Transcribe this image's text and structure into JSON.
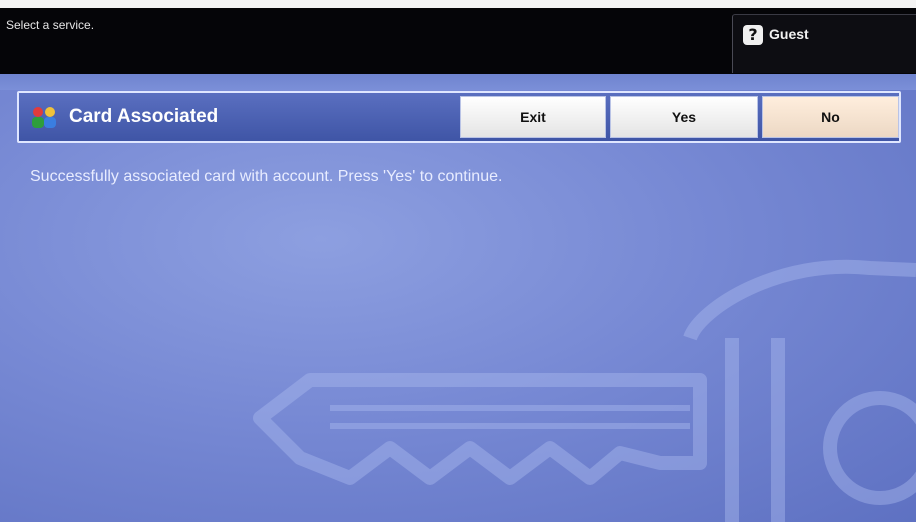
{
  "topbar": {
    "status_text": "Select a service.",
    "user_label": "Guest",
    "user_icon": "guest-user-icon"
  },
  "panel": {
    "title": "Card Associated",
    "title_icon": "people-icon",
    "buttons": {
      "exit": "Exit",
      "yes": "Yes",
      "no": "No"
    }
  },
  "message": "Successfully associated card with account. Press 'Yes' to continue.",
  "background": {
    "watermark_icon": "key-watermark-icon"
  }
}
